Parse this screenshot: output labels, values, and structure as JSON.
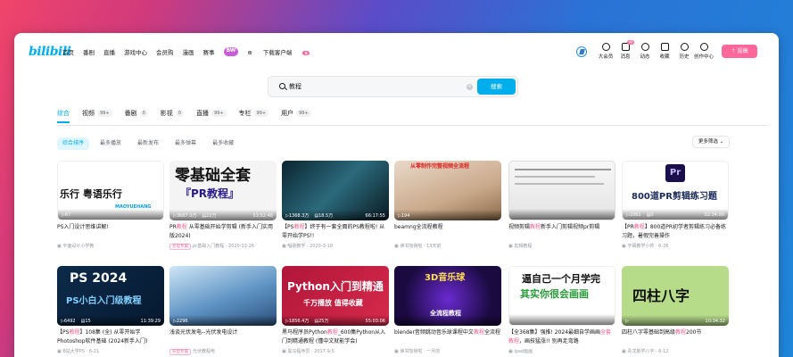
{
  "header": {
    "logo": "bilibili",
    "nav": [
      "首页",
      "番剧",
      "直播",
      "游戏中心",
      "会员购",
      "漫画",
      "赛事",
      "BW",
      "下载客户端",
      "新"
    ],
    "right": [
      {
        "label": "大会员",
        "badge": ""
      },
      {
        "label": "消息",
        "badge": "99"
      },
      {
        "label": "动态",
        "badge": ""
      },
      {
        "label": "收藏",
        "badge": ""
      },
      {
        "label": "历史",
        "badge": ""
      },
      {
        "label": "创作中心",
        "badge": ""
      }
    ],
    "upload": "投稿"
  },
  "search": {
    "value": "教程",
    "button": "搜索"
  },
  "tabs": [
    {
      "label": "综合",
      "count": ""
    },
    {
      "label": "视频",
      "count": "99+"
    },
    {
      "label": "番剧",
      "count": "0"
    },
    {
      "label": "影视",
      "count": "0"
    },
    {
      "label": "直播",
      "count": "99+"
    },
    {
      "label": "专栏",
      "count": "99+"
    },
    {
      "label": "用户",
      "count": "99+"
    }
  ],
  "filters": [
    "综合排序",
    "最多播放",
    "最新发布",
    "最多弹幕",
    "最多收藏"
  ],
  "more_filters": "更多筛选",
  "cards": [
    {
      "plays": "67",
      "dm": "",
      "dur": "",
      "overlay_text": "乐行  粤语乐行",
      "overlay2": "MAOYUEHANG",
      "title_pre": "PS入门设计思维讲解!",
      "hl": "",
      "title_post": "",
      "tag": "",
      "author": "平面设计小学教",
      "date": ""
    },
    {
      "plays": "3687.3万",
      "dm": "22万",
      "dur": "53:52:48",
      "overlay_text": "零基础全套",
      "overlay2": "『PR教程』",
      "title_pre": "PR",
      "hl": "教程",
      "title_post": " 从零基础开始学剪辑 (新手入门实用版2024)",
      "tag": "充电专属",
      "author": "pr基础入门教程",
      "date": "2020-12-26"
    },
    {
      "plays": "1368.3万",
      "dm": "18.5万",
      "dur": "66:17:55",
      "overlay_text": "",
      "overlay2": "",
      "title_pre": "【PS",
      "hl": "教程",
      "title_post": "】终于有一套全面的PS教程啦! 从零开始学PS!!",
      "tag": "",
      "author": "唱歌教学",
      "date": "2020-3-18"
    },
    {
      "plays": "194",
      "dm": "",
      "dur": "",
      "overlay_text": "从零制作完整视频全流程",
      "overlay2": "",
      "title_pre": "beam",
      "hl": "",
      "title_post": "ng全流程教程",
      "tag": "",
      "author": "读书加我啦",
      "date": "13天前"
    },
    {
      "plays": "",
      "dm": "",
      "dur": "",
      "overlay_text": "",
      "overlay2": "",
      "title_pre": "视频剪辑",
      "hl": "教程",
      "title_post": "新手入门剪辑视频pr剪辑",
      "tag": "",
      "author": "剪辑教程",
      "date": ""
    },
    {
      "plays": "1061",
      "dm": "0",
      "dur": "02:34:00",
      "overlay_text": "800道PR剪辑练习题",
      "overlay2": "Pr",
      "title_pre": "【PR",
      "hl": "教程",
      "title_post": "】800道PR初学者剪辑练习必备练习题，暑假完善操作",
      "tag": "",
      "author": "字幕教学小帅",
      "date": "6-26"
    },
    {
      "plays": "6492",
      "dm": "15",
      "dur": "11:39:29",
      "overlay_text": "PS 2024",
      "overlay2": "PS小白入门级教程",
      "title_pre": "【PS",
      "hl": "教程",
      "title_post": "】108集 (全) 从零开始学Photoshop软件基础 (2024新手入门)",
      "tag": "",
      "author": "B站大学PS",
      "date": "6-21"
    },
    {
      "plays": "2296",
      "dm": "",
      "dur": "",
      "overlay_text": "",
      "overlay2": "",
      "title_pre": "浅谈光伏发电--光伏发电设计",
      "hl": "",
      "title_post": "",
      "tag": "充电专属",
      "author": "光伏教程电",
      "date": ""
    },
    {
      "plays": "1856.4万",
      "dm": "25万",
      "dur": "55:03:06",
      "overlay_text": "Python入门到精通",
      "overlay2": "千万播放 值得收藏",
      "title_pre": "黑马程序员Python",
      "hl": "教程",
      "title_post": "_600集Python从入门到精通教程 (懂中文就能学会)",
      "tag": "",
      "author": "黑马程序员",
      "date": "2017-9-5"
    },
    {
      "plays": "",
      "dm": "",
      "dur": "",
      "overlay_text": "3D音乐球",
      "overlay2": "全流程教程",
      "title_pre": "blender音频跳动音乐球课程中文",
      "hl": "教程",
      "title_post": "全流程",
      "tag": "",
      "author": "读书加我啦",
      "date": "一月前"
    },
    {
      "plays": "",
      "dm": "",
      "dur": "",
      "overlay_text": "逼自己一个月学完",
      "overlay2": "其实你很会画画",
      "title_pre": "【全368集】强推! 2024最细自学画画",
      "hl": "全套教程",
      "title_post": "，画技猛涨!! 别再走弯路",
      "tag": "",
      "author": "ipad画画",
      "date": ""
    },
    {
      "plays": "",
      "dm": "",
      "dur": "10:34:32",
      "overlay_text": "四柱八字",
      "overlay2": "",
      "title_pre": "四柱八字零基础到高级",
      "hl": "教程",
      "title_post": "200节",
      "tag": "",
      "author": "青龙斯学八字",
      "date": "6-12"
    }
  ]
}
